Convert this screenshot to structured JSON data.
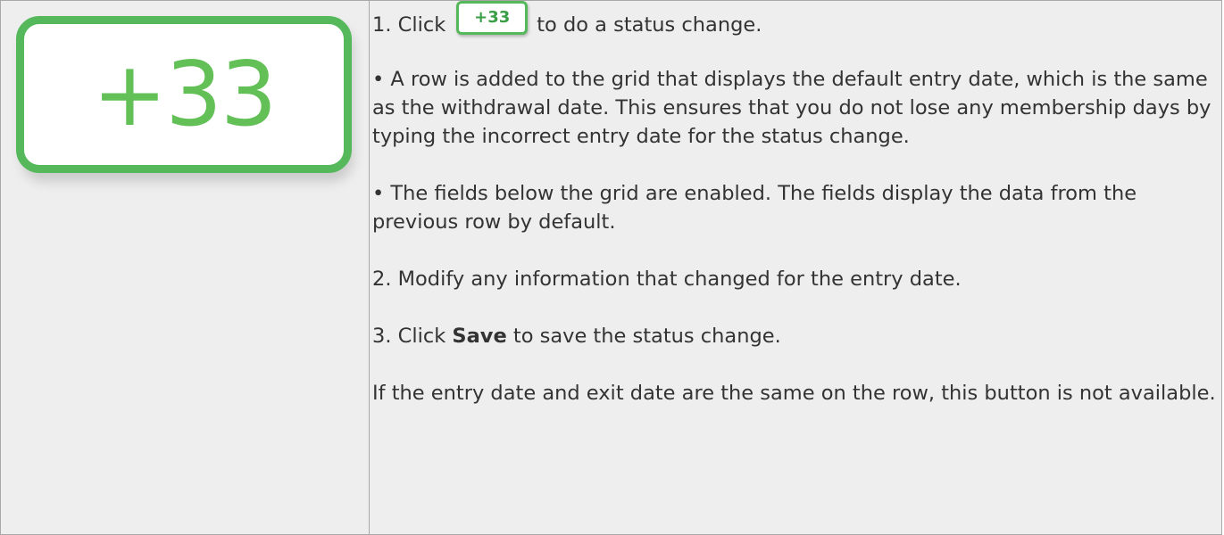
{
  "button": {
    "label": "+33",
    "color": "#55b85a",
    "icon": "plus-33-button-icon"
  },
  "steps": {
    "step1_prefix": "1. Click",
    "step1_suffix": "to do a status change.",
    "bullet1": "• A row is added to the grid that displays the default entry date, which is the same as the withdrawal date. This ensures that you do not lose any membership days by typing the incorrect entry date for the status change.",
    "bullet2": "• The fields below the grid are enabled. The fields display the data from the previous row by default.",
    "step2": "2. Modify any information that changed for the entry date.",
    "step3_prefix": "3. Click",
    "step3_bold": "Save",
    "step3_suffix": "to save the status change.",
    "note": "If the entry date and exit date are the same on the row, this button is not available."
  }
}
